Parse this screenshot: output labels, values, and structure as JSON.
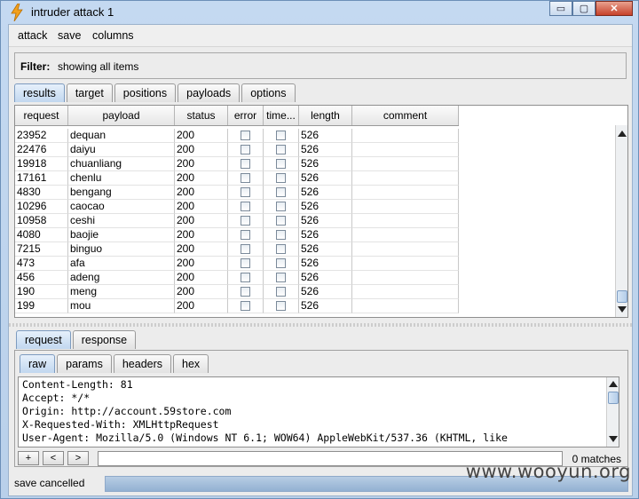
{
  "window": {
    "title": "intruder attack 1",
    "minimize": "▭",
    "maximize": "▢",
    "close": "✕"
  },
  "menu": [
    "attack",
    "save",
    "columns"
  ],
  "filter": {
    "label": "Filter:",
    "text": "showing all items"
  },
  "main_tabs": [
    {
      "label": "results",
      "active": true
    },
    {
      "label": "target",
      "active": false
    },
    {
      "label": "positions",
      "active": false
    },
    {
      "label": "payloads",
      "active": false
    },
    {
      "label": "options",
      "active": false
    }
  ],
  "table": {
    "columns": [
      "request",
      "payload",
      "status",
      "error",
      "time...",
      "length",
      "comment"
    ],
    "rows": [
      [
        "23952",
        "dequan",
        "200",
        "",
        "",
        "526",
        ""
      ],
      [
        "22476",
        "daiyu",
        "200",
        "",
        "",
        "526",
        ""
      ],
      [
        "19918",
        "chuanliang",
        "200",
        "",
        "",
        "526",
        ""
      ],
      [
        "17161",
        "chenlu",
        "200",
        "",
        "",
        "526",
        ""
      ],
      [
        "4830",
        "bengang",
        "200",
        "",
        "",
        "526",
        ""
      ],
      [
        "10296",
        "caocao",
        "200",
        "",
        "",
        "526",
        ""
      ],
      [
        "10958",
        "ceshi",
        "200",
        "",
        "",
        "526",
        ""
      ],
      [
        "4080",
        "baojie",
        "200",
        "",
        "",
        "526",
        ""
      ],
      [
        "7215",
        "binguo",
        "200",
        "",
        "",
        "526",
        ""
      ],
      [
        "473",
        "afa",
        "200",
        "",
        "",
        "526",
        ""
      ],
      [
        "456",
        "adeng",
        "200",
        "",
        "",
        "526",
        ""
      ],
      [
        "190",
        "meng",
        "200",
        "",
        "",
        "526",
        ""
      ],
      [
        "199",
        "mou",
        "200",
        "",
        "",
        "526",
        ""
      ]
    ]
  },
  "detail_tabs": [
    {
      "label": "request",
      "active": true
    },
    {
      "label": "response",
      "active": false
    }
  ],
  "view_tabs": [
    {
      "label": "raw",
      "active": true
    },
    {
      "label": "params",
      "active": false
    },
    {
      "label": "headers",
      "active": false
    },
    {
      "label": "hex",
      "active": false
    }
  ],
  "request_lines": [
    "Content-Length: 81",
    "Accept: */*",
    "Origin: http://account.59store.com",
    "X-Requested-With: XMLHttpRequest",
    "User-Agent: Mozilla/5.0 (Windows NT 6.1; WOW64) AppleWebKit/537.36 (KHTML, like"
  ],
  "search": {
    "plus": "+",
    "prev": "<",
    "next": ">",
    "value": "",
    "matches": "0 matches"
  },
  "status": {
    "text": "save cancelled"
  },
  "watermark": "www.wooyun.org"
}
